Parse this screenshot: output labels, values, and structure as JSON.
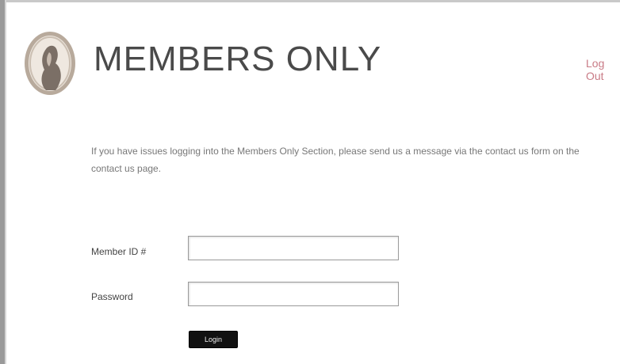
{
  "header": {
    "logo_icon": "cameo-portrait-icon",
    "title": "MEMBERS ONLY",
    "logout_label": "Log Out"
  },
  "colors": {
    "accent_link": "#c97b86",
    "button_bg": "#111111"
  },
  "notice": {
    "text": "If you have issues logging into the Members Only Section, please send us a message via the contact us form on the contact us page."
  },
  "login_form": {
    "member_id_label": "Member ID #",
    "member_id_value": "",
    "password_label": "Password",
    "password_value": "",
    "submit_label": "Login"
  }
}
